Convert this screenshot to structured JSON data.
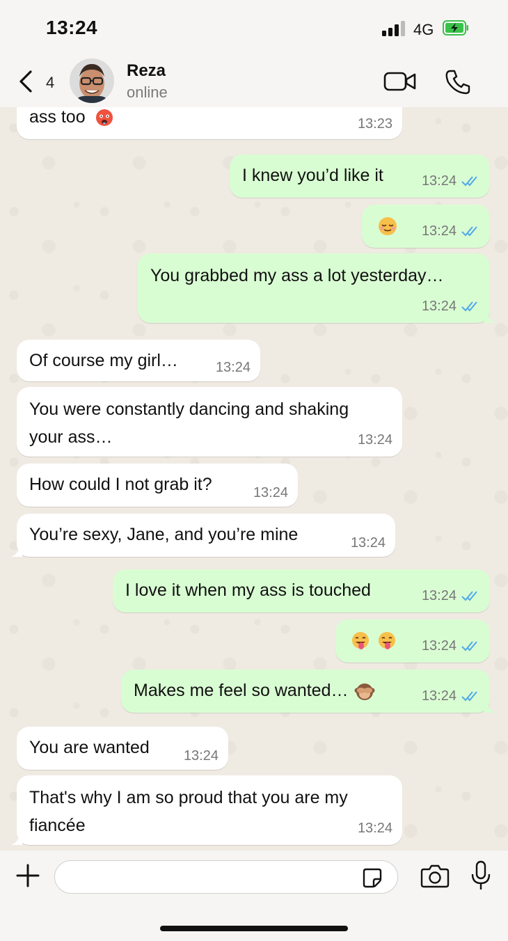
{
  "status_bar": {
    "time": "13:24",
    "network": "4G"
  },
  "header": {
    "back_count": "4",
    "contact_name": "Reza",
    "contact_status": "online"
  },
  "colors": {
    "incoming_bubble": "#ffffff",
    "outgoing_bubble": "#d9fdd3",
    "read_ticks": "#4fa8e8",
    "battery_green": "#39c24a"
  },
  "messages": [
    {
      "direction": "in",
      "text": "ass too",
      "emoji": "hot-face",
      "time": "13:23"
    },
    {
      "direction": "out",
      "text": "I knew you’d like it",
      "time": "13:24",
      "status": "read"
    },
    {
      "direction": "out",
      "text": "",
      "emoji": "relieved-face",
      "time": "13:24",
      "status": "read"
    },
    {
      "direction": "out",
      "text": "You grabbed my ass a lot yesterday…",
      "time": "13:24",
      "status": "read"
    },
    {
      "direction": "in",
      "text": "Of course my girl…",
      "time": "13:24"
    },
    {
      "direction": "in",
      "text": "You were constantly dancing and shaking",
      "text2": "your ass…",
      "time": "13:24"
    },
    {
      "direction": "in",
      "text": "How could I not grab it?",
      "time": "13:24"
    },
    {
      "direction": "in",
      "text": "You’re sexy, Jane, and you’re mine",
      "time": "13:24"
    },
    {
      "direction": "out",
      "text": "I love it when my ass is touched",
      "time": "13:24",
      "status": "read"
    },
    {
      "direction": "out",
      "text": "",
      "emoji": "tongue-wink-face x2",
      "time": "13:24",
      "status": "read"
    },
    {
      "direction": "out",
      "text": "Makes me feel so wanted…",
      "emoji": "see-no-evil-monkey",
      "time": "13:24",
      "status": "read"
    },
    {
      "direction": "in",
      "text": "You are wanted",
      "time": "13:24"
    },
    {
      "direction": "in",
      "text": "That's why I am so proud that you are my",
      "text2": "fiancée",
      "time": "13:24"
    }
  ],
  "composer": {
    "placeholder": ""
  },
  "icons": [
    "back-chevron-icon",
    "video-call-icon",
    "phone-icon",
    "plus-icon",
    "sticker-icon",
    "camera-icon",
    "microphone-icon"
  ]
}
